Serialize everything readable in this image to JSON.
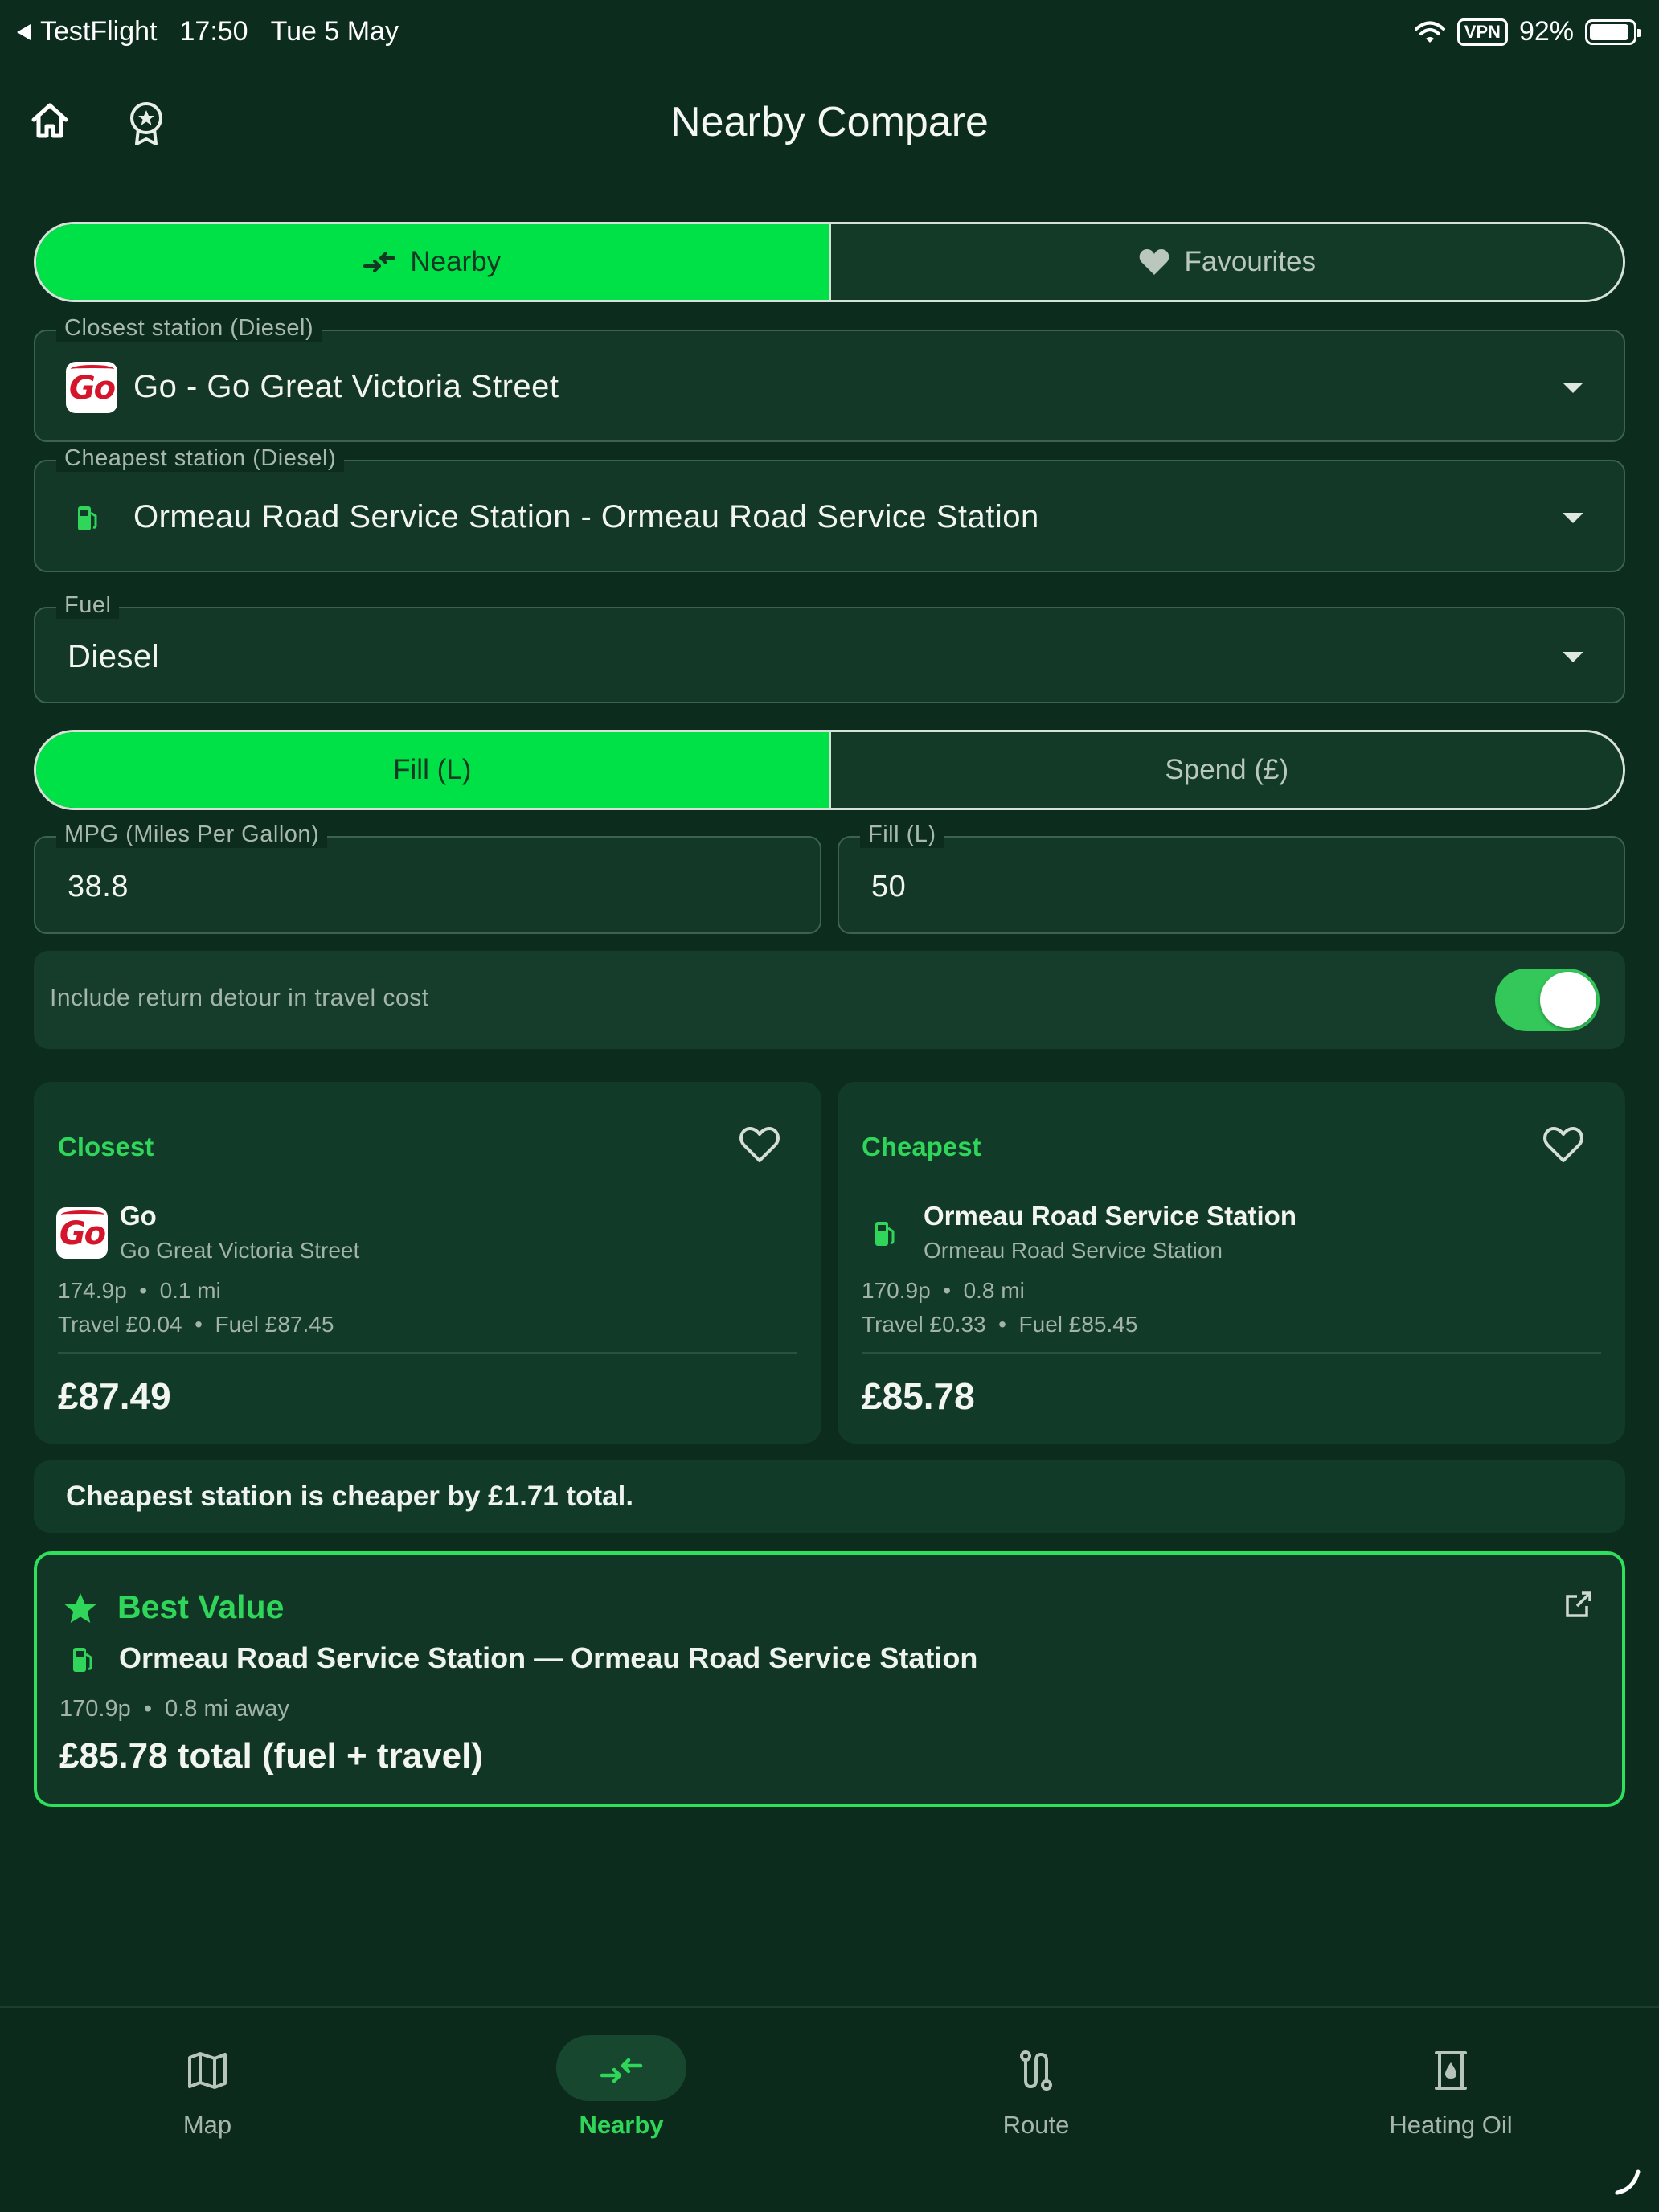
{
  "status_bar": {
    "back_app": "TestFlight",
    "time": "17:50",
    "date": "Tue 5 May",
    "vpn": "VPN",
    "battery": "92%",
    "battery_level": 0.92
  },
  "header": {
    "title": "Nearby Compare",
    "left_icons": [
      "home-icon",
      "award-icon"
    ]
  },
  "mode_tabs": {
    "items": [
      {
        "label": "Nearby",
        "icon": "compare-arrows-icon",
        "active": true
      },
      {
        "label": "Favourites",
        "icon": "heart-icon",
        "active": false
      }
    ]
  },
  "closest_select": {
    "label": "Closest station (Diesel)",
    "value": "Go - Go Great Victoria Street",
    "icon": "go-brand-logo"
  },
  "cheapest_select": {
    "label": "Cheapest station (Diesel)",
    "value": "Ormeau Road Service Station - Ormeau Road Service Station",
    "icon": "fuel-pump-icon"
  },
  "fuel_select": {
    "label": "Fuel",
    "value": "Diesel"
  },
  "amount_tabs": {
    "items": [
      {
        "label": "Fill (L)",
        "active": true
      },
      {
        "label": "Spend (£)",
        "active": false
      }
    ]
  },
  "mpg_field": {
    "label": "MPG (Miles Per Gallon)",
    "value": "38.8"
  },
  "fill_field": {
    "label": "Fill (L)",
    "value": "50"
  },
  "return_toggle": {
    "label": "Include return detour in travel cost",
    "on": true
  },
  "closest_card": {
    "kind": "Closest",
    "brand": "Go",
    "station": "Go Great Victoria Street",
    "price": "174.9p",
    "distance": "0.1 mi",
    "travel": "Travel £0.04",
    "fuel": "Fuel £87.45",
    "total": "£87.49"
  },
  "cheapest_card": {
    "kind": "Cheapest",
    "brand": "Ormeau Road Service Station",
    "station": "Ormeau Road Service Station",
    "price": "170.9p",
    "distance": "0.8 mi",
    "travel": "Travel £0.33",
    "fuel": "Fuel £85.45",
    "total": "£85.78"
  },
  "difference": {
    "text": "Cheapest station is cheaper by £1.71 total."
  },
  "best_value": {
    "title": "Best Value",
    "station": "Ormeau Road Service Station — Ormeau Road Service Station",
    "price": "170.9p",
    "distance": "0.8 mi away",
    "total": "£85.78 total (fuel + travel)"
  },
  "bottom_nav": {
    "items": [
      {
        "label": "Map",
        "icon": "map-icon",
        "active": false
      },
      {
        "label": "Nearby",
        "icon": "compare-arrows-icon",
        "active": true
      },
      {
        "label": "Route",
        "icon": "route-icon",
        "active": false
      },
      {
        "label": "Heating Oil",
        "icon": "oil-tank-icon",
        "active": false
      }
    ]
  },
  "colors": {
    "background": "#0c2c1d",
    "accent": "#00e148",
    "accent_text": "#2fd65a",
    "card": "#123a28"
  }
}
